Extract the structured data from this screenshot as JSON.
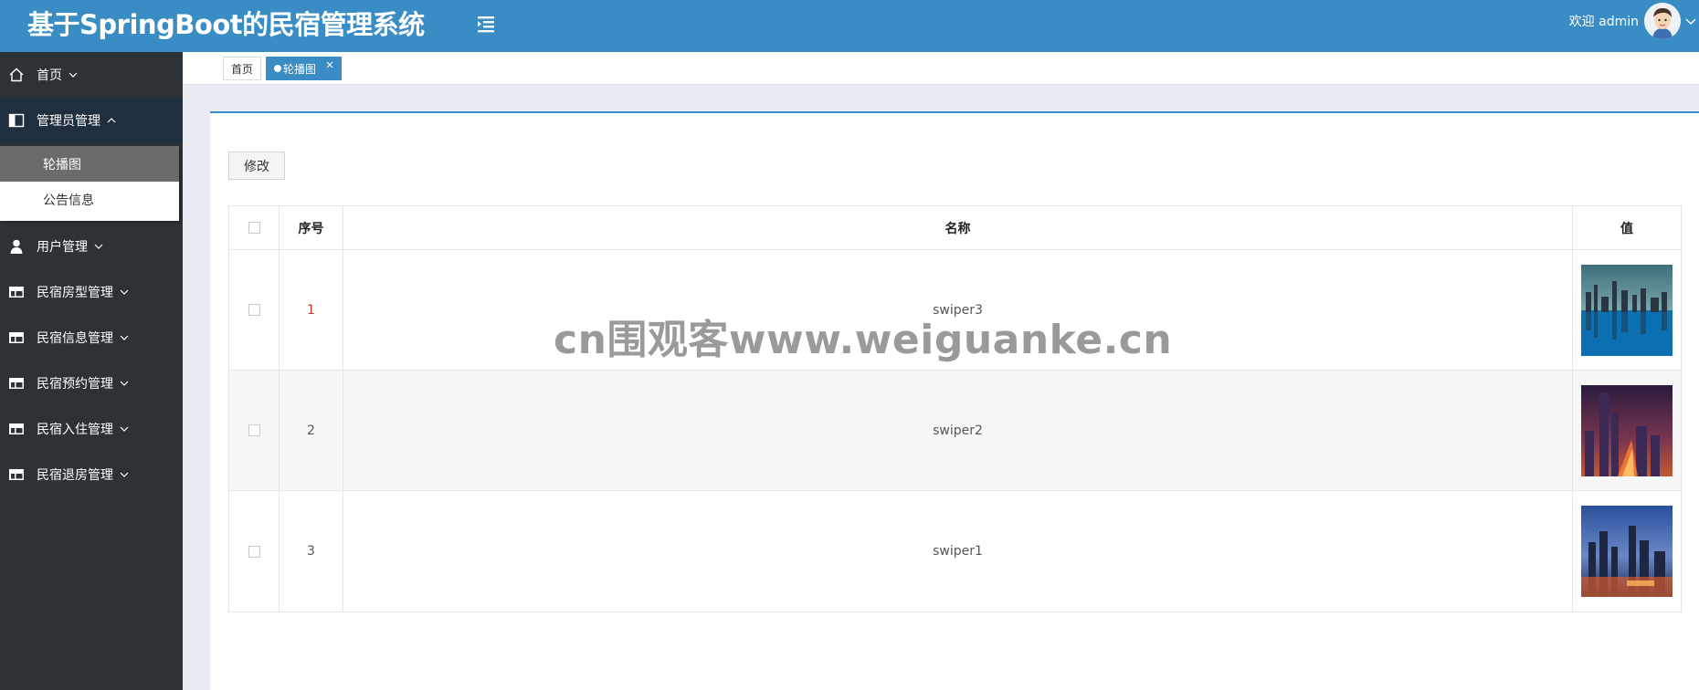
{
  "header": {
    "title": "基于SpringBoot的民宿管理系统",
    "welcome": "欢迎 admin",
    "bg_color": "#3a8dc4"
  },
  "sidebar": {
    "bg_color": "#2c3236",
    "items": [
      {
        "label": "首页",
        "icon": "home-icon",
        "expanded": false
      },
      {
        "label": "管理员管理",
        "icon": "admin-panel-icon",
        "expanded": true,
        "children": [
          {
            "label": "轮播图",
            "active": true
          },
          {
            "label": "公告信息",
            "active": false
          }
        ]
      },
      {
        "label": "用户管理",
        "icon": "user-icon",
        "expanded": false
      },
      {
        "label": "民宿房型管理",
        "icon": "table-icon",
        "expanded": false
      },
      {
        "label": "民宿信息管理",
        "icon": "table-icon",
        "expanded": false
      },
      {
        "label": "民宿预约管理",
        "icon": "table-icon",
        "expanded": false
      },
      {
        "label": "民宿入住管理",
        "icon": "table-icon",
        "expanded": false
      },
      {
        "label": "民宿退房管理",
        "icon": "table-icon",
        "expanded": false
      }
    ]
  },
  "tabs": [
    {
      "label": "首页",
      "active": false
    },
    {
      "label": "轮播图",
      "active": true,
      "closable": true
    }
  ],
  "toolbar": {
    "edit_label": "修改"
  },
  "table": {
    "columns": [
      "序号",
      "名称",
      "值"
    ],
    "rows": [
      {
        "index": "1",
        "name": "swiper3",
        "image": "city-skyline-reflection-thumbnail"
      },
      {
        "index": "2",
        "name": "swiper2",
        "image": "city-night-tower-thumbnail"
      },
      {
        "index": "3",
        "name": "swiper1",
        "image": "city-dusk-skyline-thumbnail"
      }
    ]
  },
  "watermark": "cn围观客www.weiguanke.cn"
}
